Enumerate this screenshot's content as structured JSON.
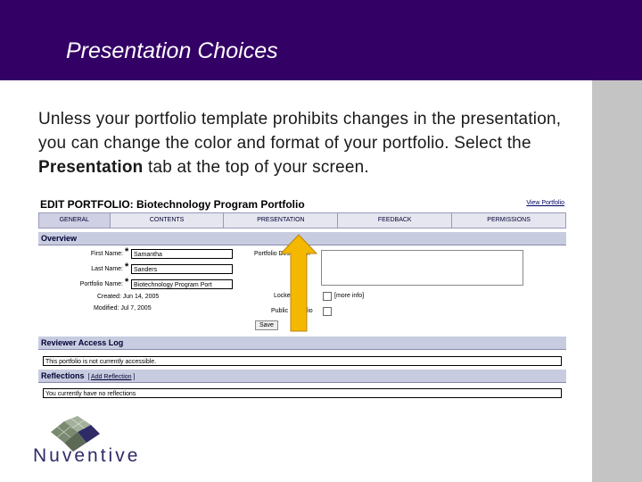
{
  "slide": {
    "title": "Presentation Choices",
    "body_prefix": "Unless your portfolio template prohibits changes in the presentation, you can change the color and format of your portfolio. Select the ",
    "body_bold": "Presentation",
    "body_suffix": " tab at the top of your screen."
  },
  "screenshot": {
    "title": "EDIT PORTFOLIO: Biotechnology Program Portfolio",
    "view_link": "View Portfolio",
    "tabs": [
      "GENERAL",
      "CONTENTS",
      "PRESENTATION",
      "FEEDBACK",
      "PERMISSIONS"
    ],
    "overview": {
      "heading": "Overview",
      "first_name_label": "First Name:",
      "first_name_value": "Samantha",
      "last_name_label": "Last Name:",
      "last_name_value": "Sanders",
      "portfolio_name_label": "Portfolio Name:",
      "portfolio_name_value": "Biotechnology Program Port",
      "created": "Created: Jun 14, 2005",
      "modified": "Modified: Jul 7, 2005",
      "description_label": "Portfolio Description",
      "locked_label": "Locked",
      "more_info": "[more info]",
      "public_label": "Public Portfolio",
      "save_label": "Save"
    },
    "reviewer": {
      "heading": "Reviewer Access Log",
      "text": "This portfolio is not currently accessible."
    },
    "reflections": {
      "heading": "Reflections",
      "add_link": "Add Reflection",
      "text": "You currently have no reflections"
    }
  },
  "logo": {
    "text": "Nuventive"
  },
  "colors": {
    "header": "#330066",
    "sidebar": "#c4c4c4",
    "arrow": "#f5b800",
    "logo": "#2e2b67"
  }
}
